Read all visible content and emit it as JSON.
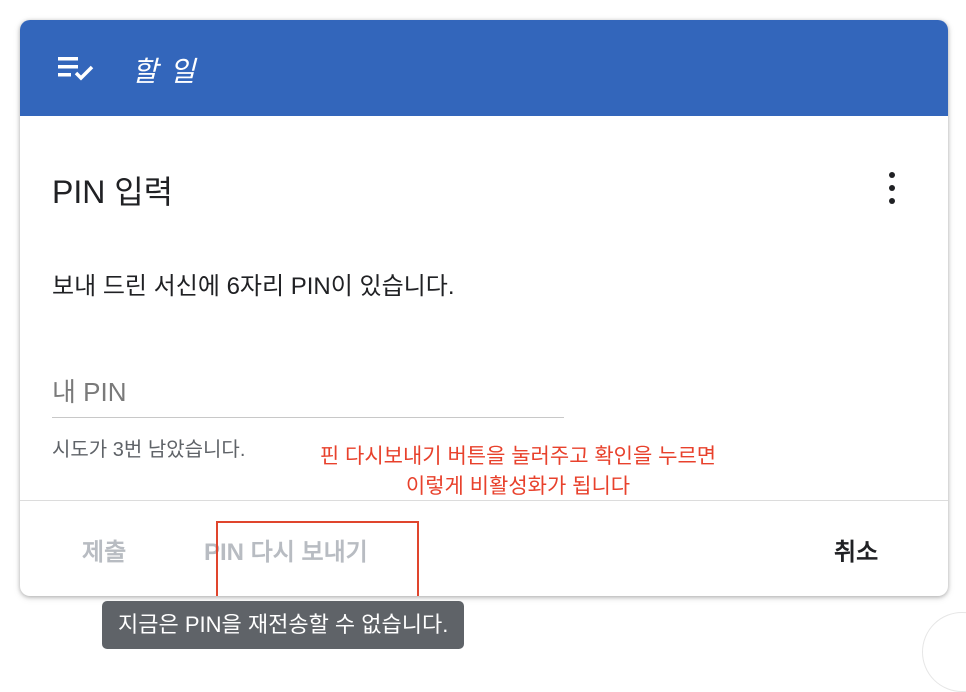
{
  "header": {
    "title": "할 일",
    "icon": "checklist-icon"
  },
  "dialog": {
    "title": "PIN 입력",
    "menu_icon": "more-vert-icon",
    "description": "보내 드린 서신에 6자리 PIN이 있습니다.",
    "pin_field": {
      "placeholder": "내 PIN",
      "value": ""
    },
    "attempts_text": "시도가 3번 남았습니다."
  },
  "annotation": {
    "line1": "핀 다시보내기 버튼을 눌러주고 확인을 누르면",
    "line2": "이렇게 비활성화가 됩니다",
    "color": "#e8412c"
  },
  "footer": {
    "submit_label": "제출",
    "resend_label": "PIN 다시 보내기",
    "cancel_label": "취소"
  },
  "tooltip": {
    "text": "지금은 PIN을 재전송할 수 없습니다."
  },
  "colors": {
    "header_bg": "#3366bb",
    "disabled_text": "#b8bcc2",
    "highlight": "#e0452d"
  }
}
